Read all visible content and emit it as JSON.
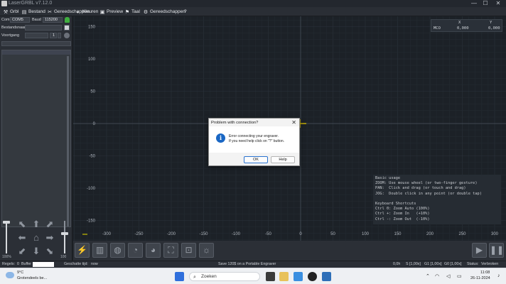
{
  "window": {
    "title": "LaserGRBL v7.12.0",
    "minimize": "—",
    "maximize": "☐",
    "close": "✕"
  },
  "menu": [
    {
      "label": "Grbl",
      "icon": "wrench-icon",
      "glyph": "⚒"
    },
    {
      "label": "Bestand",
      "icon": "document-icon",
      "glyph": "▤"
    },
    {
      "label": "Gereedschappen",
      "icon": "tools-icon",
      "glyph": "✂"
    },
    {
      "label": "Kleuren",
      "icon": "palette-icon",
      "glyph": "◐"
    },
    {
      "label": "Preview",
      "icon": "preview-icon",
      "glyph": "▣"
    },
    {
      "label": "Taal",
      "icon": "flag-icon",
      "glyph": "⚑"
    },
    {
      "label": "Gereedschappen",
      "icon": "settings-icon",
      "glyph": "⚙"
    },
    {
      "label": "?",
      "icon": "",
      "glyph": ""
    }
  ],
  "left": {
    "com_label": "Com",
    "com_value": "COM5",
    "baud_label": "Baud",
    "baud_value": "115200",
    "file_label": "Bestandsnaam",
    "progress_label": "Voortgang",
    "progress_count": "1",
    "speed_left": "100%",
    "speed_right": "100"
  },
  "position": {
    "x_label": "X",
    "y_label": "Y",
    "mco_label": "MCO",
    "x_value": "0,000",
    "y_value": "0,000"
  },
  "axes": {
    "y_ticks": [
      "150",
      "100",
      "50",
      "0",
      "-50",
      "-100",
      "-150"
    ],
    "x_ticks": [
      "-300",
      "-250",
      "-200",
      "-150",
      "-100",
      "-50",
      "0",
      "50",
      "100",
      "150",
      "200",
      "250",
      "300"
    ]
  },
  "help": {
    "lines": [
      "Basic usage",
      "ZOOM: Use mouse wheel (or two-finger gesture)",
      "PAN:  Click and drag (or touch and drag)",
      "JOG:  Double click in any point (or double tap)",
      "",
      "Keyboard Shortcuts",
      "Ctrl 0: Zoom Auto (100%)",
      "Ctrl +: Zoom In   (+10%)",
      "Ctrl -: Zoom Out  (-10%)"
    ]
  },
  "dialog": {
    "title": "Problem with connection?",
    "close": "✕",
    "line1": "Error connecting your engraver.",
    "line2": "If you need help click on \"?\" button.",
    "ok": "OK",
    "help": "Help"
  },
  "status": {
    "lines_label": "Regels:",
    "lines_value": "0",
    "buffer_label": "Buffer",
    "est_label": "Geschatte tijd:",
    "est_value": "now",
    "promo": "Save 120$ on a Portable Engraver",
    "time": "0,0h",
    "s_value": "S [1,00x]",
    "g1_value": "G1 [1,00x]",
    "g0_value": "G0 [1,00x]",
    "status_label": "Status:",
    "status_value": "Verbroken"
  },
  "taskbar": {
    "temp": "9°C",
    "weather": "Grotendeels be...",
    "search": "Zoeken",
    "time": "11:08",
    "date": "26-11-2024"
  },
  "colors": {
    "accent": "#f0d000",
    "canvas": "#1c2127",
    "grid": "#262d35",
    "dialog_button": "#2b73cf"
  }
}
